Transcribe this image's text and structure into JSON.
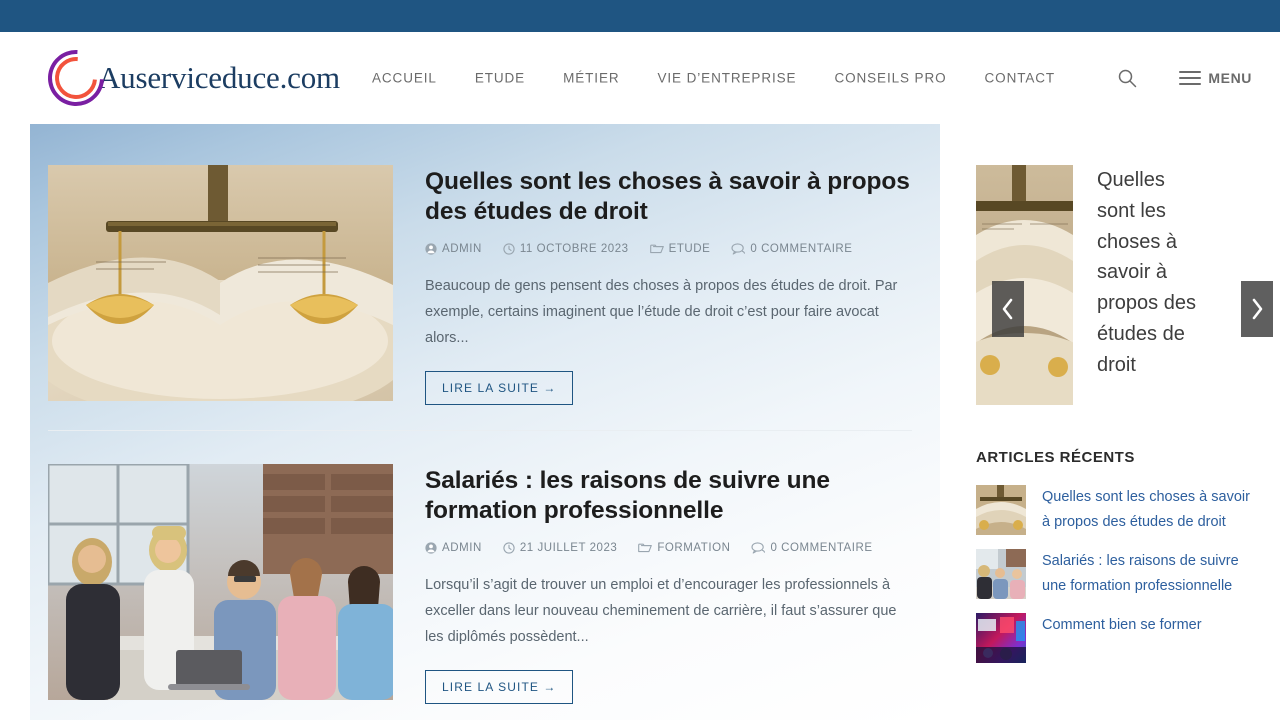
{
  "site": {
    "brand_name": "Auserviceduce.com",
    "logo_outer_color": "#7a1fa2",
    "logo_inner_color": "#f2533c",
    "topbar_color": "#1f5582",
    "accent_color": "#1f5582",
    "link_color": "#2d5f9e"
  },
  "nav": {
    "items": [
      {
        "label": "ACCUEIL"
      },
      {
        "label": "ETUDE"
      },
      {
        "label": "MÉTIER"
      },
      {
        "label": "VIE D’ENTREPRISE"
      },
      {
        "label": "CONSEILS PRO"
      },
      {
        "label": "CONTACT"
      }
    ],
    "search_icon": "search-icon",
    "menu_label": "MENU",
    "menu_icon": "hamburger-icon"
  },
  "posts": [
    {
      "title": "Quelles sont les choses à savoir à propos des études de droit",
      "author": "ADMIN",
      "date": "11 OCTOBRE 2023",
      "category": "ETUDE",
      "comments": "0 COMMENTAIRE",
      "excerpt": "Beaucoup de gens pensent des choses à propos des études de droit. Par exemple, certains imaginent que l’étude de droit c’est pour faire avocat alors...",
      "read_more": "LIRE LA SUITE →",
      "image_alt": "balance-de-justice-sur-livre-ouvert"
    },
    {
      "title": "Salariés : les raisons de suivre une formation professionnelle",
      "author": "ADMIN",
      "date": "21 JUILLET 2023",
      "category": "FORMATION",
      "comments": "0 COMMENTAIRE",
      "excerpt": "Lorsqu’il s’agit de trouver un emploi et d’encourager les professionnels à exceller dans leur nouveau cheminement de carrière, il faut s’assurer que les diplômés possèdent...",
      "read_more": "LIRE LA SUITE →",
      "image_alt": "equipe-en-reunion-de-formation"
    }
  ],
  "sidebar": {
    "slider": {
      "title": "Quelles sont les choses à savoir à propos des études de droit",
      "prev_icon": "chevron-left-icon",
      "next_icon": "chevron-right-icon",
      "image_alt": "livre-ouvert-avec-balance"
    },
    "recent_widget_title": "ARTICLES RÉCENTS",
    "recent_items": [
      {
        "title": "Quelles sont les choses à savoir à propos des études de droit",
        "image_alt": "balance-de-justice"
      },
      {
        "title": "Salariés : les raisons de suivre une formation professionnelle",
        "image_alt": "reunion-de-bureau"
      },
      {
        "title": "Comment bien se former",
        "image_alt": "ecran-lumineux-colore"
      }
    ]
  }
}
